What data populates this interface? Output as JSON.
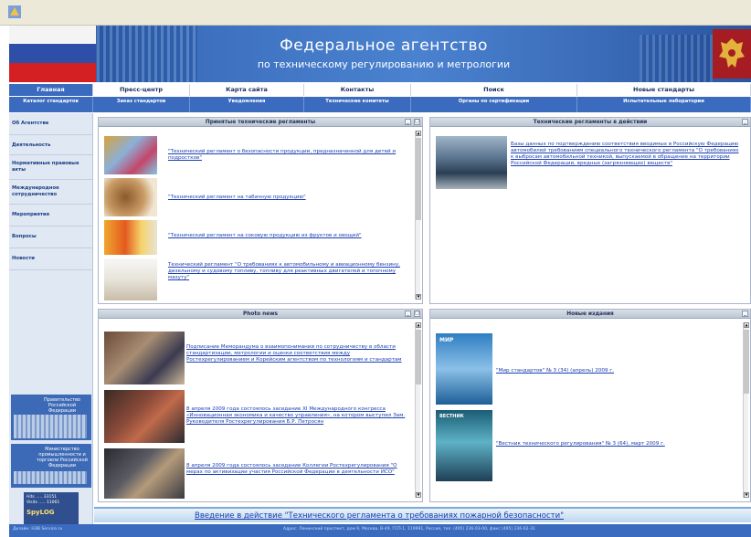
{
  "banner": {
    "title": "Федеральное агентство",
    "subtitle": "по техническому регулированию и метрологии"
  },
  "nav_top": [
    "Главная",
    "Пресс-центр",
    "Карта сайта",
    "Контакты",
    "Поиск",
    "Новые стандарты"
  ],
  "nav_bottom": [
    "Каталог стандартов",
    "Заказ стандартов",
    "Уведомления",
    "Технические комитеты",
    "Органы по сертификации",
    "Испытательные лаборатории"
  ],
  "sidebar": {
    "items": [
      "Об Агентстве",
      "Деятельность",
      "Нормативные правовые акты",
      "Международное сотрудничество",
      "Мероприятия",
      "Вопросы",
      "Новости"
    ],
    "promo1": "Правительство Российской Федерации",
    "promo2": "Министерство промышленности и торговли Российской Федерации",
    "counter_hits": "Hits",
    "counter_visits": "Visits",
    "counter_hits_value": "33151",
    "counter_visits_value": "11061"
  },
  "panels": {
    "reglaments": {
      "title": "Принятые технические регламенты",
      "items": [
        "\"Технический регламент о безопасности продукции, предназначенной для детей и подростков\"",
        "\"Технический регламент на табачную продукцию\"",
        "\"Технический регламент на соковую продукцию из фруктов и овощей\"",
        "Технический регламент \"О требованиях к автомобильному и авиационному бензину, дизельному и судовому топливу, топливу для реактивных двигателей и топочному мазуту\""
      ]
    },
    "active": {
      "title": "Технические регламенты в действии",
      "text": "Базы данных по подтверждению соответствия вводимых в Российскую Федерацию автомобилей требованиям специального технического регламента \"О требованиях к выбросам автомобильной техникой, выпускаемой в обращение на территории Российской Федерации, вредных (загрязняющих) веществ\""
    },
    "photo": {
      "title": "Photo news",
      "items": [
        "Подписание Меморандума о взаимопонимании по сотрудничеству в области стандартизации, метрологии и оценки соответствия между Ростехрегулированием и Корейским агентством по технологиям и стандартам",
        "8 апреля 2009 года состоялось заседание XI Международного конгресса «Инновационная экономика и качество управления», на котором выступил Зам. Руководителя Ростехрегулирования Б.Р. Петросян",
        "8 апреля 2009 года состоялось заседание Коллегии Ростехрегулирования \"О мерах по активизации участия Российской Федерации в деятельности ИСО\""
      ]
    },
    "editions": {
      "title": "Новые издания",
      "items": [
        "\"Мир стандартов\" № 3 (34) (апрель) 2009 г.",
        "\"Вестник технического регулирования\" № 3 (64), март 2009 г."
      ],
      "cover1": "МИР",
      "cover2": "ВЕСТНИК"
    }
  },
  "bottom_banner": "Введение в действие \"Технического регламента о требованиях пожарной безопасности\"",
  "footer": {
    "left": "Дизайн: НЭВ Service.ru",
    "right": "Адрес: Ленинский проспект, дом 9, Москва, В-49, ГСП-1, 119991, Россия, тел. (495) 236-03-00, факс (495) 236-62-31"
  },
  "colors": {
    "brand_blue": "#3a6bbf",
    "link": "#1a3db0",
    "sidebar_bg": "#dfe8f3"
  }
}
